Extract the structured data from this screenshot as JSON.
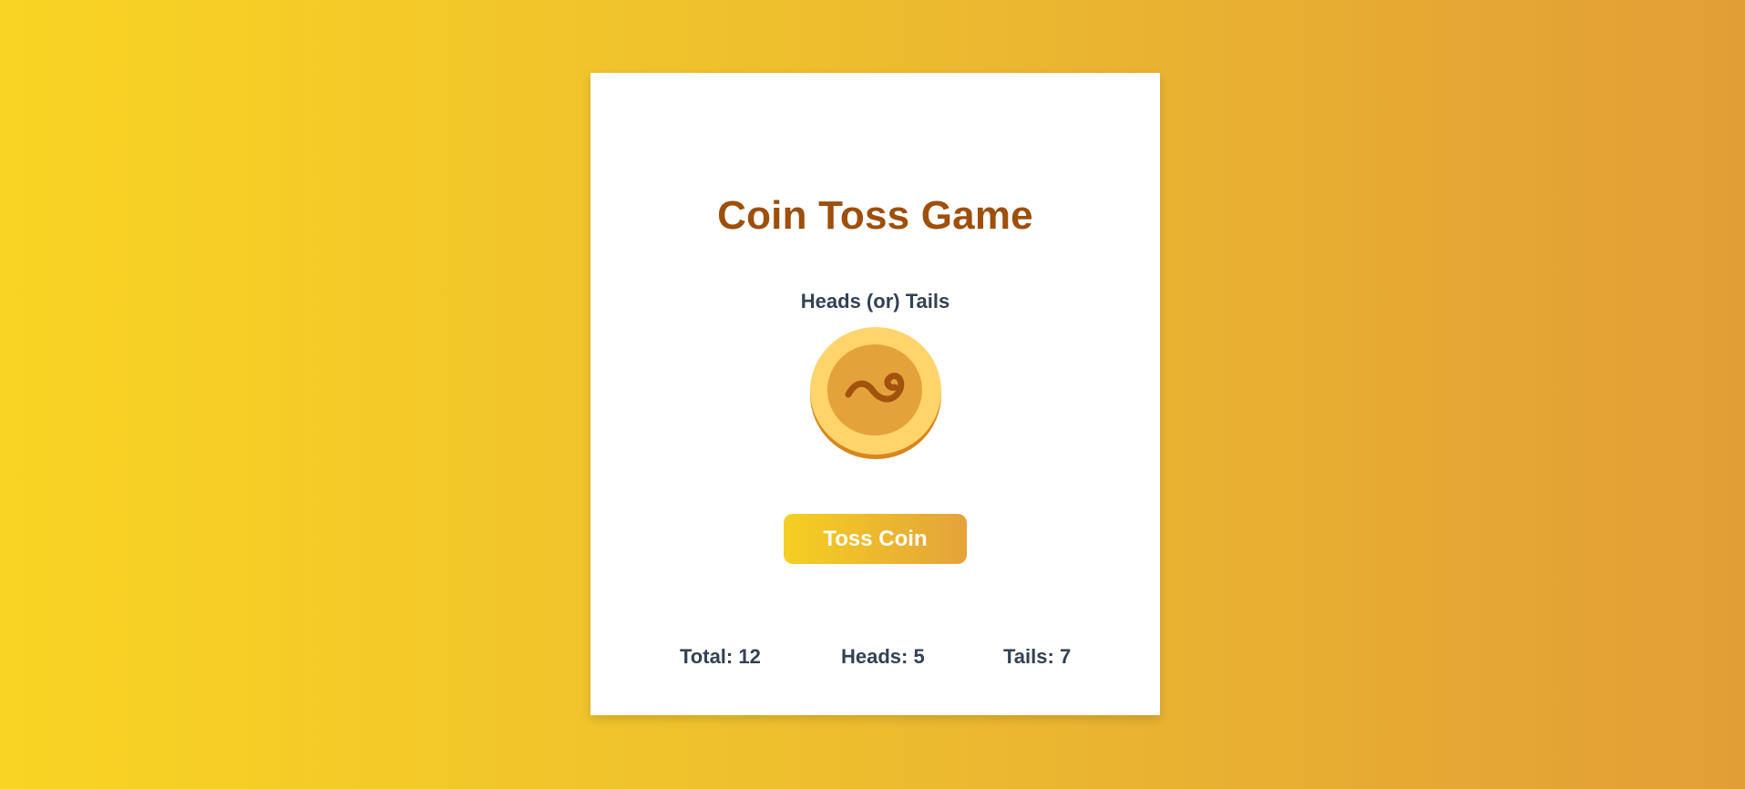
{
  "game": {
    "title": "Coin Toss Game",
    "subtitle": "Heads (or) Tails",
    "coin_face": "tails",
    "coin_icon": "swirl-icon",
    "toss_button_label": "Toss Coin"
  },
  "stats": {
    "total_label": "Total: 12",
    "heads_label": "Heads: 5",
    "tails_label": "Tails: 7"
  },
  "colors": {
    "background_start": "#f9d423",
    "background_end": "#e29e36",
    "title": "#9e4f0b",
    "text": "#334155",
    "coin_outer": "#ffd46a",
    "coin_inner": "#e4a23b",
    "coin_rim": "#d8861f",
    "swirl": "#a3520d"
  }
}
